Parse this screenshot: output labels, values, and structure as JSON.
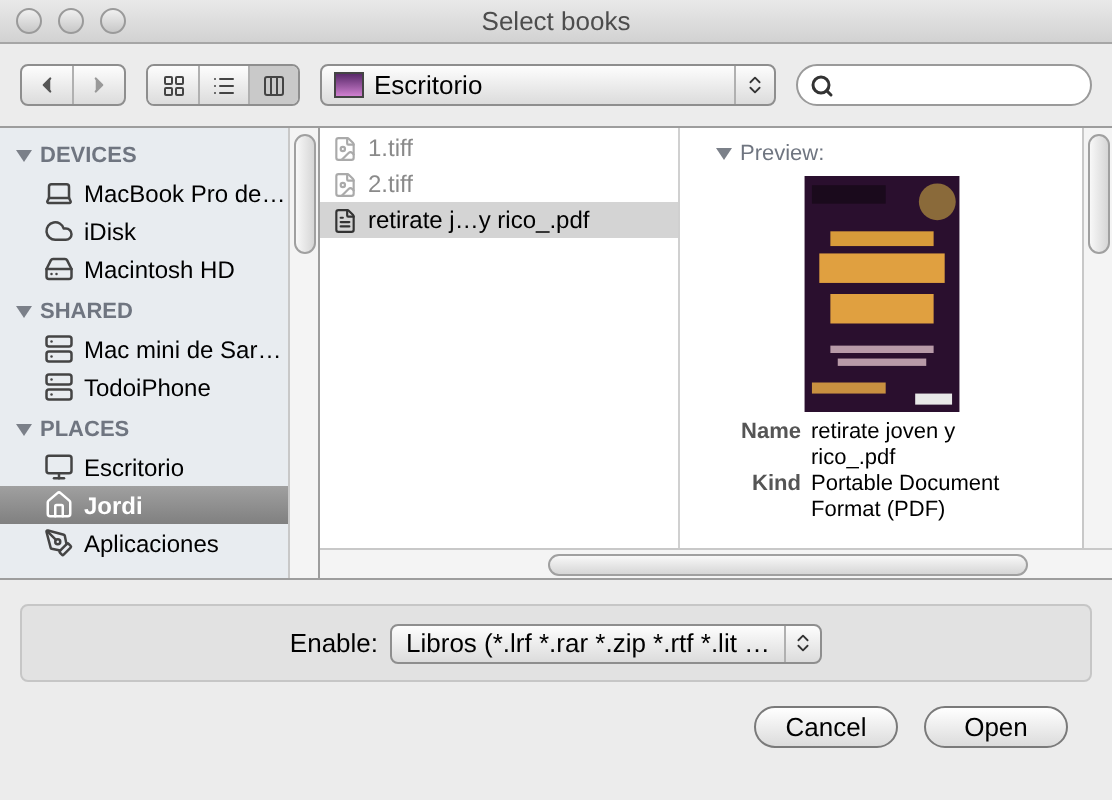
{
  "window": {
    "title": "Select books"
  },
  "toolbar": {
    "view_modes": [
      {
        "kind": "icon",
        "selected": false
      },
      {
        "kind": "list",
        "selected": false
      },
      {
        "kind": "column",
        "selected": true
      }
    ],
    "location": "Escritorio"
  },
  "sidebar": {
    "sections": [
      {
        "title": "DEVICES",
        "expanded": true,
        "items": [
          {
            "label": "MacBook Pro de…",
            "kind": "laptop",
            "selected": false
          },
          {
            "label": "iDisk",
            "kind": "cloud",
            "selected": false
          },
          {
            "label": "Macintosh HD",
            "kind": "disk",
            "selected": false
          }
        ]
      },
      {
        "title": "SHARED",
        "expanded": true,
        "items": [
          {
            "label": "Mac mini de Sar…",
            "kind": "server",
            "selected": false
          },
          {
            "label": "TodoiPhone",
            "kind": "server",
            "selected": false
          }
        ]
      },
      {
        "title": "PLACES",
        "expanded": true,
        "items": [
          {
            "label": "Escritorio",
            "kind": "desktop",
            "selected": false
          },
          {
            "label": "Jordi",
            "kind": "home",
            "selected": true
          },
          {
            "label": "Aplicaciones",
            "kind": "apps",
            "selected": false
          }
        ]
      }
    ]
  },
  "files": [
    {
      "name": "1.tiff",
      "selected": false,
      "disabled": true
    },
    {
      "name": "2.tiff",
      "selected": false,
      "disabled": true
    },
    {
      "name": "retirate j…y rico_.pdf",
      "selected": true,
      "disabled": false
    }
  ],
  "preview": {
    "heading": "Preview:",
    "expanded": true,
    "fields": [
      {
        "label": "Name",
        "value": "retirate joven y rico_.pdf"
      },
      {
        "label": "Kind",
        "value": "Portable Document Format (PDF)"
      }
    ]
  },
  "filter": {
    "label": "Enable:",
    "value": "Libros (*.lrf *.rar *.zip *.rtf *.lit …"
  },
  "buttons": [
    "Cancel",
    "Open"
  ]
}
